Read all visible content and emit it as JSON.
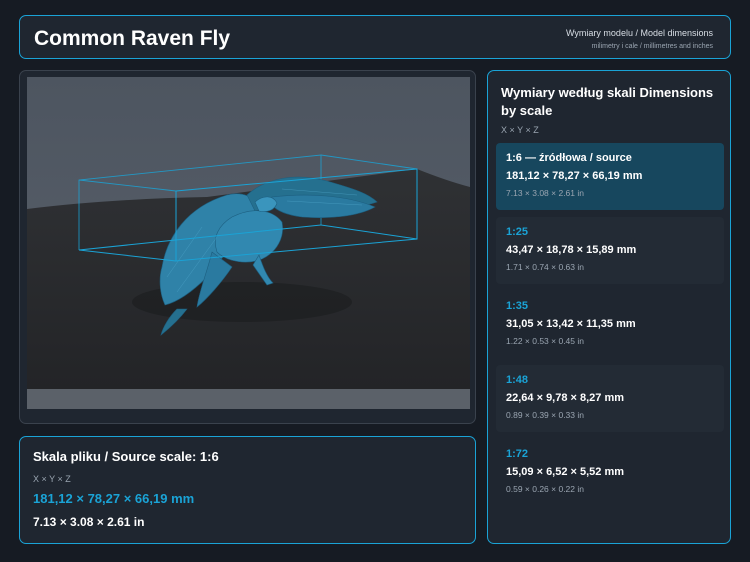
{
  "header": {
    "title": "Common Raven Fly",
    "subtitle": "Wymiary modelu / Model dimensions",
    "subtitle_small": "milimetry i cale / millimetres and inches"
  },
  "source": {
    "heading": "Skala pliku / Source scale: 1:6",
    "axes": "X × Y × Z",
    "mm": "181,12 × 78,27 × 66,19 mm",
    "inch": "7.13 × 3.08 × 2.61 in"
  },
  "scales": {
    "heading": "Wymiary według skali Dimensions by scale",
    "axes": "X × Y × Z",
    "items": [
      {
        "ratio": "1:6 — źródłowa / source",
        "mm": "181,12 × 78,27 × 66,19 mm",
        "inch": "7.13 × 3.08 × 2.61 in"
      },
      {
        "ratio": "1:25",
        "mm": "43,47 × 18,78 × 15,89 mm",
        "inch": "1.71 × 0.74 × 0.63 in"
      },
      {
        "ratio": "1:35",
        "mm": "31,05 × 13,42 × 11,35 mm",
        "inch": "1.22 × 0.53 × 0.45 in"
      },
      {
        "ratio": "1:48",
        "mm": "22,64 × 9,78 × 8,27 mm",
        "inch": "0.89 × 0.39 × 0.33 in"
      },
      {
        "ratio": "1:72",
        "mm": "15,09 × 6,52 × 5,52 mm",
        "inch": "0.59 × 0.26 × 0.22 in"
      }
    ]
  },
  "colors": {
    "accent": "#1aa3d6",
    "panel": "#1f2630",
    "background": "#161b23",
    "active_item": "#17475e",
    "model": "#2a7aa0"
  }
}
